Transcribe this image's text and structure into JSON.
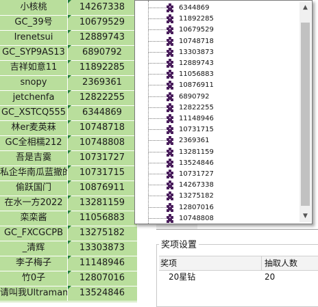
{
  "sheet": {
    "rows": [
      {
        "name": "小核桃",
        "value": "14267338"
      },
      {
        "name": "GC_39号",
        "value": "10679529"
      },
      {
        "name": "Irenetsui",
        "value": "12889743"
      },
      {
        "name": "GC_SYP9AS13",
        "value": "6890792"
      },
      {
        "name": "吉祥如意11",
        "value": "11892285"
      },
      {
        "name": "snopy",
        "value": "2369361"
      },
      {
        "name": "jetchenfa",
        "value": "12822255"
      },
      {
        "name": "GC_XSTCQ555",
        "value": "6344869"
      },
      {
        "name": "林er麦英菻",
        "value": "10748718"
      },
      {
        "name": "GC全相檽212",
        "value": "10748808"
      },
      {
        "name": "吾是吉霙",
        "value": "10731727"
      },
      {
        "name": "私企华南瓜蓝撤的",
        "value": "10731715"
      },
      {
        "name": "偷跃国门",
        "value": "10876911"
      },
      {
        "name": "在水一方2022",
        "value": "13281159"
      },
      {
        "name": "栾栾酱",
        "value": "11056883"
      },
      {
        "name": "GC_FXCGCPB",
        "value": "13275182"
      },
      {
        "name": "_清辉",
        "value": "13303873"
      },
      {
        "name": "李子梅子",
        "value": "11148946"
      },
      {
        "name": "竹0子",
        "value": "12807016"
      },
      {
        "name": "请叫我Ultraman",
        "value": "13524846"
      }
    ]
  },
  "dropdown": {
    "items": [
      "6344869",
      "11892285",
      "10679529",
      "10748718",
      "13303873",
      "12889743",
      "11056883",
      "10876911",
      "6890792",
      "12822255",
      "11148946",
      "10731715",
      "2369361",
      "13281159",
      "13524846",
      "10731727",
      "14267338",
      "13275182",
      "12807016",
      "10748808"
    ],
    "scroll_up_icon": "triangle-up",
    "scroll_down_icon": "triangle-down",
    "node_icon": "puzzle-piece-icon",
    "node_icon_color": "#4a1f5c"
  },
  "prize": {
    "group_title": "奖项设置",
    "col_prize": "奖项",
    "col_count": "抽取人数",
    "rows": [
      {
        "prize": "20星钻",
        "count": "20"
      }
    ]
  },
  "colors": {
    "sheet_bg": "#b9de9c",
    "accent": "#1f7a3a"
  }
}
